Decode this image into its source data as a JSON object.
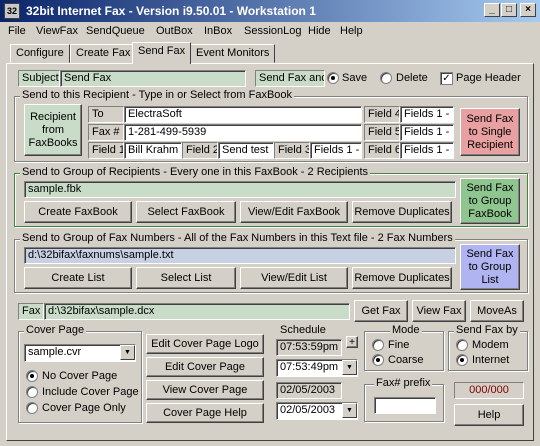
{
  "window": {
    "title": "32bit Internet Fax - Version i9.50.01 - Workstation 1",
    "icon_label": "32",
    "controls": [
      "_",
      "□",
      "×"
    ]
  },
  "menu": [
    "File",
    "ViewFax",
    "SendQueue",
    "OutBox",
    "InBox",
    "SessionLog",
    "Hide",
    "Help"
  ],
  "tabs": [
    "Configure",
    "Create Fax",
    "Send Fax",
    "Event Monitors"
  ],
  "subject": {
    "label": "Subject",
    "value": "Send Fax"
  },
  "send_fax_and": {
    "label": "Send Fax and",
    "save": "Save",
    "delete": "Delete",
    "selected": "Save"
  },
  "page_header": {
    "label": "Page Header",
    "checked": true
  },
  "recipient": {
    "legend": "Send to this Recipient - Type in or Select from FaxBook",
    "from_faxbooks": "Recipient from FaxBooks",
    "to_label": "To",
    "to_value": "ElectraSoft",
    "fax_label": "Fax #",
    "fax_value": "1-281-499-5939",
    "field1_label": "Field 1",
    "field1_value": "Bill Krahm",
    "field2_label": "Field 2",
    "field2_value": "Send test",
    "field3_label": "Field 3",
    "field3_value": "Fields 1 -",
    "field4_label": "Field 4",
    "field4_value": "Fields 1 -",
    "field5_label": "Field 5",
    "field5_value": "Fields 1 -",
    "field6_label": "Field 6",
    "field6_value": "Fields 1 -",
    "send_single": "Send Fax to Single Recipient"
  },
  "group_recipients": {
    "legend": "Send to Group of Recipients - Every one in this FaxBook - 2 Recipients",
    "file": "sample.fbk",
    "create": "Create FaxBook",
    "select": "Select FaxBook",
    "view_edit": "View/Edit FaxBook",
    "remove_dup": "Remove Duplicates",
    "send": "Send Fax to Group FaxBook"
  },
  "group_numbers": {
    "legend": "Send to Group of Fax Numbers - All of the Fax Numbers in this Text file - 2 Fax Numbers",
    "file": "d:\\32bifax\\faxnums\\sample.txt",
    "create": "Create List",
    "select": "Select List",
    "view_edit": "View/Edit List",
    "remove_dup": "Remove Duplicates",
    "send": "Send Fax to Group List"
  },
  "fax_file": {
    "label": "Fax",
    "value": "d:\\32bifax\\sample.dcx",
    "get": "Get Fax",
    "view": "View Fax",
    "move": "MoveAs"
  },
  "cover_page": {
    "legend": "Cover Page",
    "selected": "sample.cvr",
    "options": [
      "No Cover Page",
      "Include Cover Page",
      "Cover Page Only"
    ],
    "selected_option": "No Cover Page",
    "edit_logo": "Edit Cover Page Logo",
    "edit": "Edit Cover Page",
    "view": "View Cover Page",
    "help": "Cover Page Help"
  },
  "schedule": {
    "legend": "Schedule",
    "time_display": "07:53:59pm",
    "time_select": "07:53:49pm",
    "date_display": "02/05/2003",
    "date_select": "02/05/2003",
    "plus": "+"
  },
  "mode": {
    "legend": "Mode",
    "options": [
      "Fine",
      "Coarse"
    ],
    "selected": "Coarse"
  },
  "send_by": {
    "legend": "Send Fax by",
    "options": [
      "Modem",
      "Internet"
    ],
    "selected": "Internet"
  },
  "prefix": {
    "legend": "Fax# prefix",
    "value": ""
  },
  "counter": "000/000",
  "help": "Help"
}
